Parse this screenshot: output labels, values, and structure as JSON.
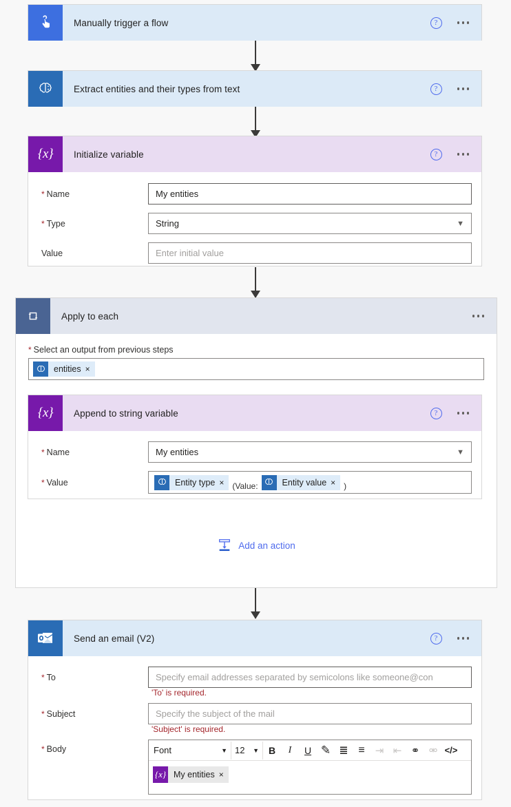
{
  "flow": {
    "steps": [
      {
        "id": "manual-trigger",
        "title": "Manually trigger a flow",
        "icon": "tap-hand-icon",
        "icon_color": "#3d6fe0",
        "header_color": "#dceaf7"
      },
      {
        "id": "extract-entities",
        "title": "Extract entities and their types from text",
        "icon": "brain-icon",
        "icon_color": "#2a6cb5",
        "header_color": "#dceaf7"
      },
      {
        "id": "initialize-variable",
        "title": "Initialize variable",
        "icon": "variable-braces-icon",
        "icon_color": "#7719aa",
        "header_color": "#e9dcf2",
        "fields": [
          {
            "label": "Name",
            "required": true,
            "value": "My entities",
            "placeholder": "",
            "type": "text"
          },
          {
            "label": "Type",
            "required": true,
            "value": "String",
            "placeholder": "",
            "type": "select"
          },
          {
            "label": "Value",
            "required": false,
            "value": "",
            "placeholder": "Enter initial value",
            "type": "text"
          }
        ]
      },
      {
        "id": "apply-to-each",
        "title": "Apply to each",
        "icon": "loop-repeat-icon",
        "icon_color": "#4a6493",
        "header_color": "#e1e5ee",
        "select_label": "Select an output from previous steps",
        "select_required": true,
        "select_token": {
          "text": "entities",
          "icon": "brain-icon",
          "remove": "×"
        },
        "add_action_label": "Add an action",
        "add_action_icon": "add-action-icon",
        "inner": {
          "id": "append-to-string-variable",
          "title": "Append to string variable",
          "icon": "variable-braces-icon",
          "icon_color": "#7719aa",
          "header_color": "#e9dcf2",
          "name_label": "Name",
          "name_value": "My entities",
          "value_label": "Value",
          "value_tokens": [
            {
              "kind": "token",
              "text": "Entity type",
              "icon": "brain-icon",
              "remove": "×"
            },
            {
              "kind": "text",
              "text": "(Value:"
            },
            {
              "kind": "token",
              "text": "Entity value",
              "icon": "brain-icon",
              "remove": "×"
            },
            {
              "kind": "text",
              "text": ")"
            }
          ]
        }
      },
      {
        "id": "send-an-email",
        "title": "Send an email (V2)",
        "icon": "outlook-icon",
        "icon_color": "#2a6cb5",
        "header_color": "#dceaf7",
        "fields": [
          {
            "label": "To",
            "required": true,
            "value": "",
            "placeholder": "Specify email addresses separated by semicolons like someone@con",
            "error": "'To' is required."
          },
          {
            "label": "Subject",
            "required": true,
            "value": "",
            "placeholder": "Specify the subject of the mail",
            "error": "'Subject' is required."
          },
          {
            "label": "Body",
            "required": true,
            "type": "richtext"
          }
        ],
        "richtext": {
          "font_label": "Font",
          "size_label": "12",
          "buttons": [
            {
              "name": "bold-button",
              "glyph": "B",
              "enabled": true
            },
            {
              "name": "italic-button",
              "glyph": "I",
              "enabled": true
            },
            {
              "name": "underline-button",
              "glyph": "U",
              "enabled": true
            },
            {
              "name": "highlighter-icon",
              "glyph": "✎",
              "enabled": true
            },
            {
              "name": "bulleted-list-button",
              "glyph": "≣",
              "enabled": true
            },
            {
              "name": "numbered-list-button",
              "glyph": "≡",
              "enabled": true
            },
            {
              "name": "indent-button",
              "glyph": "⇥",
              "enabled": false
            },
            {
              "name": "outdent-button",
              "glyph": "⇤",
              "enabled": false
            },
            {
              "name": "link-button",
              "glyph": "⚭",
              "enabled": true
            },
            {
              "name": "unlink-button",
              "glyph": "⚮",
              "enabled": false
            },
            {
              "name": "code-view-button",
              "glyph": "</>",
              "enabled": true
            }
          ],
          "body_token": {
            "text": "My entities",
            "icon": "variable-braces-icon",
            "remove": "×"
          }
        }
      }
    ],
    "help_glyph": "?",
    "variable_glyph": "{x}"
  }
}
